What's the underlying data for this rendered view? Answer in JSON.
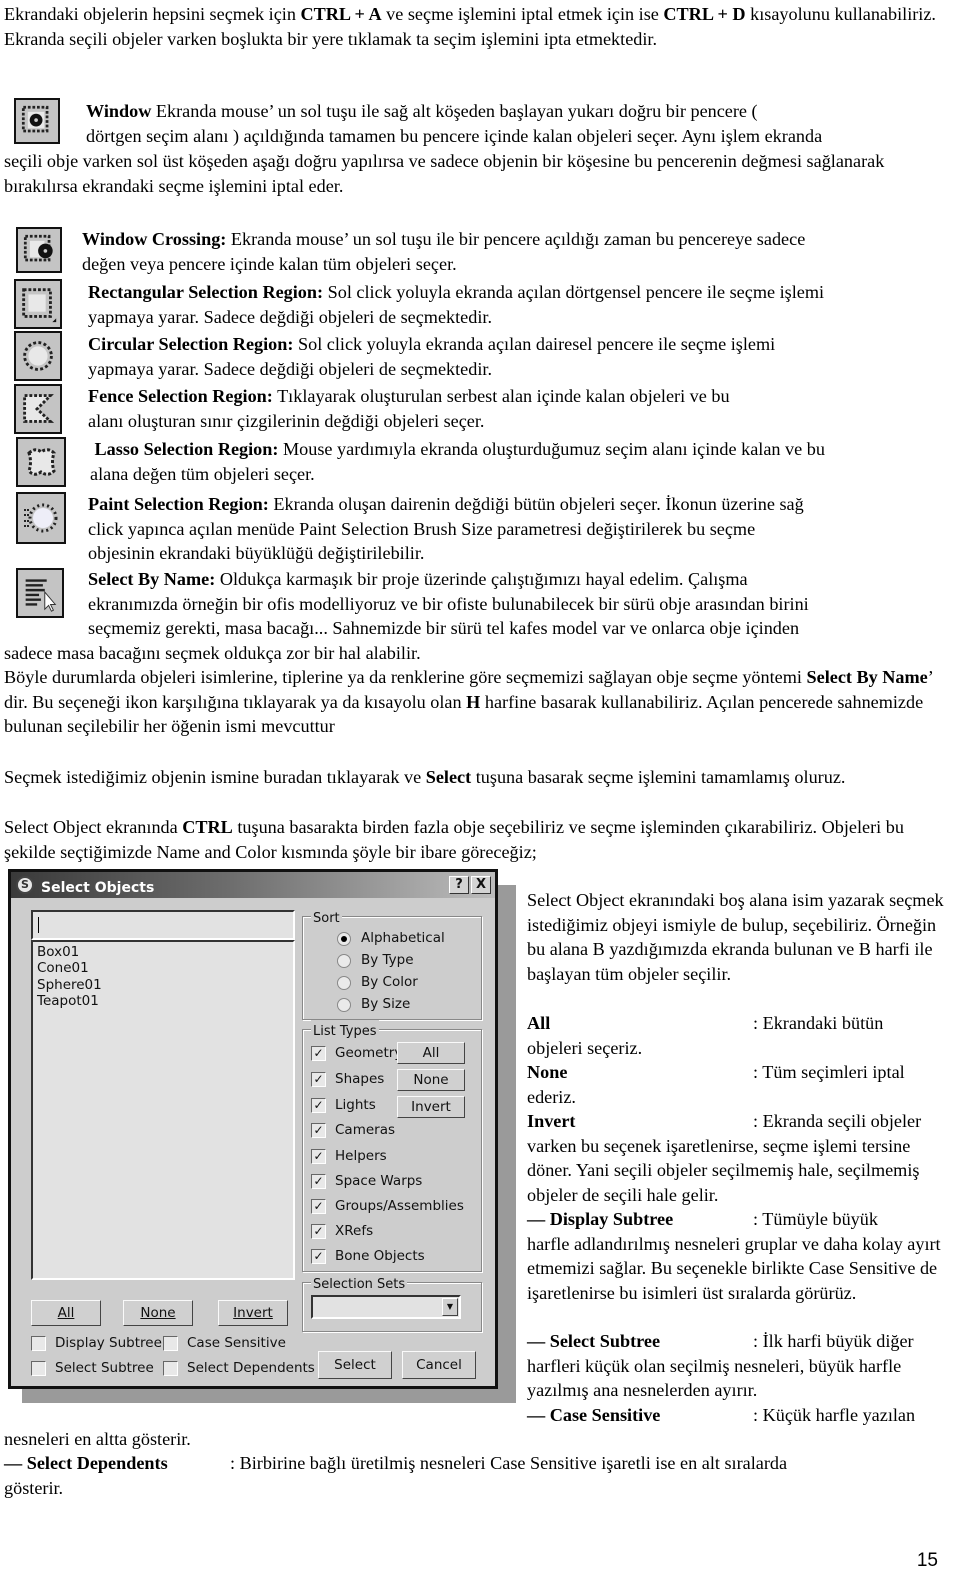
{
  "intro": {
    "p1_a": "Ekrandaki objelerin hepsini seçmek için ",
    "p1_key1": "CTRL + A",
    "p1_b": " ve seçme işlemini iptal etmek için ise ",
    "p1_key2": "CTRL + D",
    "p1_c": " kısayolunu kullanabiliriz. Ekranda seçili objeler varken boşlukta bir yere tıklamak ta seçim işlemini ipta etmektedir."
  },
  "window_section": {
    "icon": "window-selection-icon",
    "title": "Window",
    "line1": " Ekranda mouse’ un sol tuşu ile sağ alt köşeden başlayan yukarı doğru bir pencere   (",
    "line2": "dörtgen seçim alanı ) açıldığında tamamen bu pencere içinde kalan objeleri seçer. Aynı işlem ekranda",
    "rest": "seçili obje varken sol üst köşeden aşağı doğru yapılırsa ve sadece objenin bir köşesine bu pencerenin değmesi sağlanarak bırakılırsa ekrandaki seçme işlemini iptal eder."
  },
  "selection_modes": [
    {
      "icon": "window-crossing-icon",
      "title": "Window Crossing:",
      "text": " Ekranda mouse’ un sol tuşu ile bir pencere açıldığı zaman bu pencereye sadece",
      "text2": "değen veya pencere içinde kalan tüm objeleri seçer."
    },
    {
      "icon": "rectangular-selection-icon",
      "title": "Rectangular Selection Region:",
      "text": " Sol click yoluyla ekranda açılan dörtgensel pencere ile seçme işlemi",
      "text2": "yapmaya yarar. Sadece değdiği objeleri de seçmektedir."
    },
    {
      "icon": "circular-selection-icon",
      "title": "Circular Selection Region:",
      "text": " Sol click yoluyla ekranda açılan dairesel pencere ile seçme işlemi",
      "text2": "yapmaya yarar. Sadece değdiği objeleri de seçmektedir."
    },
    {
      "icon": "fence-selection-icon",
      "title": "Fence Selection Region:",
      "text": " Tıklayarak oluşturulan serbest alan içinde kalan objeleri ve bu",
      "text2": "alanı oluşturan sınır çizgilerinin değdiği objeleri seçer."
    },
    {
      "icon": "lasso-selection-icon",
      "title": "Lasso Selection Region:",
      "text": " Mouse yardımıyla ekranda oluşturduğumuz seçim alanı içinde kalan ve bu",
      "text2": "alana değen tüm objeleri seçer."
    },
    {
      "icon": "paint-selection-icon",
      "title": "Paint Selection Region:",
      "text": " Ekranda oluşan dairenin değdiği bütün objeleri seçer. İkonun üzerine sağ",
      "text2": "click yapınca açılan menüde Paint Selection Brush Size parametresi değiştirilerek bu seçme",
      "text3": "objesinin ekrandaki büyüklüğü değiştirilebilir."
    }
  ],
  "select_by_name": {
    "icon": "select-by-name-icon",
    "title": "Select By Name:",
    "l1": " Oldukça karmaşık bir proje üzerinde çalıştığımızı hayal edelim. Çalışma",
    "l2": "ekranımızda örneğin bir ofis modelliyoruz ve bir ofiste bulunabilecek bir sürü obje arasından birini",
    "l3": "seçmemiz gerekti, masa bacağı... Sahnemizde bir sürü tel kafes model var ve onlarca obje içinden",
    "l4": "sadece masa bacağını seçmek oldukça zor bir hal alabilir.",
    "p2_a": "Böyle durumlarda objeleri isimlerine, tiplerine ya da renklerine göre seçmemizi sağlayan obje seçme yöntemi ",
    "p2_b": "Select By Name",
    "p2_c": "’ dir. Bu seçeneği ikon karşılığına tıklayarak ya da kısayolu olan ",
    "p2_d": "H",
    "p2_e": " harfine basarak kullanabiliriz. Açılan pencerede sahnemizde bulunan seçilebilir her öğenin ismi mevcuttur",
    "p3_a": "Seçmek istediğimiz objenin ismine buradan tıklayarak ve ",
    "p3_b": "Select",
    "p3_c": " tuşuna basarak seçme işlemini tamamlamış oluruz.",
    "p4_a": "Select Object ekranında ",
    "p4_b": "CTRL",
    "p4_c": " tuşuna basarakta birden fazla obje seçebiliriz ve seçme işleminden çıkarabiliriz. Objeleri bu şekilde seçtiğimizde Name and Color kısmında şöyle bir ibare göreceğiz;"
  },
  "dialog": {
    "title": "Select Objects",
    "help_label": "?",
    "close_label": "X",
    "name_value": "",
    "objects": [
      "Box01",
      "Cone01",
      "Sphere01",
      "Teapot01"
    ],
    "list_buttons": {
      "all": "All",
      "none": "None",
      "invert": "Invert"
    },
    "options": [
      {
        "label": "Display Subtree",
        "checked": false
      },
      {
        "label": "Case Sensitive",
        "checked": false
      },
      {
        "label": "Select Subtree",
        "checked": false
      },
      {
        "label": "Select Dependents",
        "checked": false
      }
    ],
    "sort": {
      "label": "Sort",
      "options": [
        {
          "label": "Alphabetical",
          "selected": true
        },
        {
          "label": "By Type",
          "selected": false
        },
        {
          "label": "By Color",
          "selected": false
        },
        {
          "label": "By Size",
          "selected": false
        }
      ]
    },
    "list_types": {
      "label": "List Types",
      "items": [
        {
          "label": "Geometry",
          "checked": true
        },
        {
          "label": "Shapes",
          "checked": true
        },
        {
          "label": "Lights",
          "checked": true
        },
        {
          "label": "Cameras",
          "checked": true
        },
        {
          "label": "Helpers",
          "checked": true
        },
        {
          "label": "Space Warps",
          "checked": true
        },
        {
          "label": "Groups/Assemblies",
          "checked": true
        },
        {
          "label": "XRefs",
          "checked": true
        },
        {
          "label": "Bone Objects",
          "checked": true
        }
      ],
      "buttons": {
        "all": "All",
        "none": "None",
        "invert": "Invert"
      }
    },
    "selection_sets": {
      "label": "Selection Sets",
      "value": ""
    },
    "select_label": "Select",
    "cancel_label": "Cancel"
  },
  "right_column": {
    "intro": "Select Object ekranındaki boş alana isim yazarak seçmek istediğimiz objeyi ismiyle de bulup, seçebiliriz.  Örneğin bu alana B yazdığımızda ekranda bulunan ve B harfi ile başlayan tüm objeler seçilir.",
    "defs": [
      {
        "term": "All",
        "desc": ": Ekrandaki bütün",
        "cont": "objeleri seçeriz."
      },
      {
        "term": "None",
        "desc": ": Tüm seçimleri iptal",
        "cont": "ederiz."
      },
      {
        "term": "Invert",
        "desc": ": Ekranda seçili objeler",
        "cont": "varken bu seçenek işaretlenirse, seçme işlemi tersine döner. Yani seçili objeler seçilmemiş hale, seçilmemiş objeler de seçili hale gelir."
      },
      {
        "term": "— Display Subtree",
        "desc": ": Tümüyle büyük",
        "cont": "harfle adlandırılmış nesneleri gruplar ve daha kolay ayırt etmemizi sağlar. Bu seçenekle birlikte Case Sensitive de işaretlenirse bu isimleri üst sıralarda görürüz."
      },
      {
        "term": "— Select Subtree",
        "desc": ": İlk harfi büyük diğer",
        "cont": "harfleri küçük olan seçilmiş nesneleri, büyük harfle yazılmış ana nesnelerden ayırır."
      },
      {
        "term": "— Case Sensitive",
        "desc": ": Küçük harfle yazılan",
        "cont": ""
      }
    ]
  },
  "footer": {
    "case_cont": "nesneleri en altta gösterir.",
    "dep_term": "— Select Dependents",
    "dep_desc": ": Birbirine bağlı üretilmiş nesneleri Case Sensitive işaretli ise en alt sıralarda",
    "dep_cont": "gösterir.",
    "page_number": "15"
  }
}
